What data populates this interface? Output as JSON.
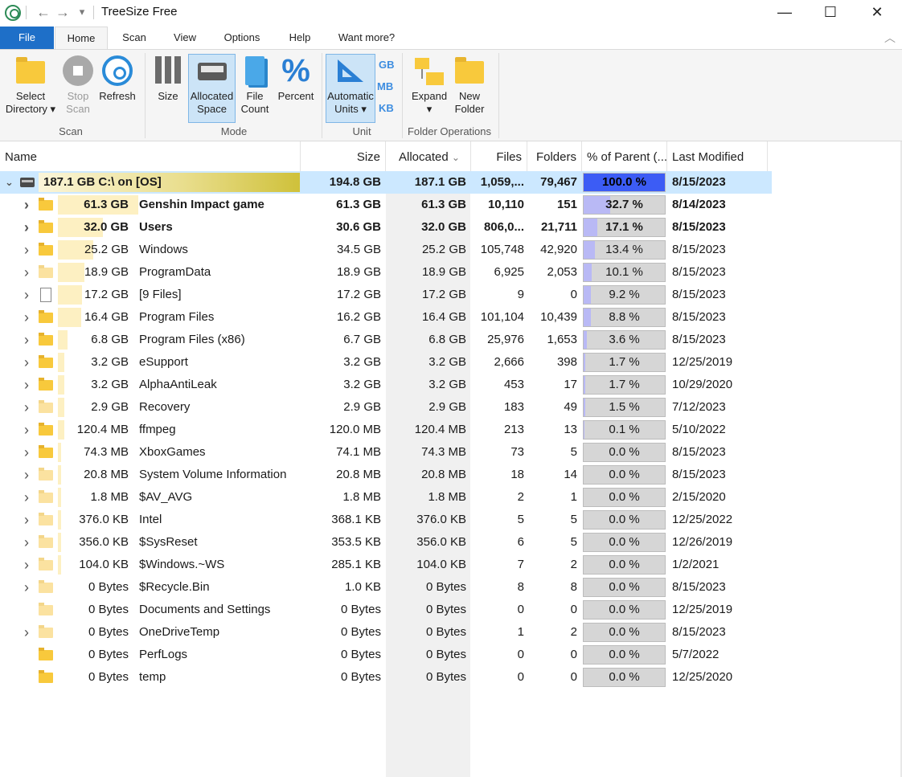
{
  "window": {
    "title": "TreeSize Free",
    "minimize_icon": "—",
    "maximize_icon": "☐",
    "close_icon": "✕",
    "back_icon": "←",
    "forward_icon": "→",
    "quickaccess_icon": "▾"
  },
  "ribbon_tabs": [
    "File",
    "Home",
    "Scan",
    "View",
    "Options",
    "Help",
    "Want more?"
  ],
  "collapse_icon": "︿",
  "ribbon": {
    "scan_group": {
      "label": "Scan",
      "select_directory": [
        "Select",
        "Directory ▾"
      ],
      "stop_scan": [
        "Stop",
        "Scan"
      ],
      "refresh": "Refresh"
    },
    "mode_group": {
      "label": "Mode",
      "size": "Size",
      "allocated_space": [
        "Allocated",
        "Space"
      ],
      "file_count": [
        "File",
        "Count"
      ],
      "percent": "Percent",
      "percent_glyph": "%"
    },
    "unit_group": {
      "label": "Unit",
      "automatic_units": [
        "Automatic",
        "Units ▾"
      ],
      "gb": "GB",
      "mb": "MB",
      "kb": "KB"
    },
    "folder_ops_group": {
      "label": "Folder Operations",
      "expand": [
        "Expand",
        "▾"
      ],
      "new_folder": [
        "New",
        "Folder"
      ]
    }
  },
  "columns": [
    "Name",
    "Size",
    "Allocated",
    "Files",
    "Folders",
    "% of Parent (...",
    "Last Modified"
  ],
  "sort_indicator": "⌄",
  "root": {
    "label": "187.1 GB   C:\\  on  [OS]",
    "size": "194.8 GB",
    "allocated": "187.1 GB",
    "files": "1,059,...",
    "folders": "79,467",
    "percent": "100.0 %",
    "percent_value": 100.0,
    "modified": "8/15/2023"
  },
  "rows": [
    {
      "alloc_label": "61.3 GB",
      "name": "Genshin Impact game",
      "size": "61.3 GB",
      "allocated": "61.3 GB",
      "files": "10,110",
      "folders": "151",
      "percent": "32.7 %",
      "percent_value": 32.7,
      "modified": "8/14/2023",
      "bold": true,
      "expandable": true,
      "icon": "folder"
    },
    {
      "alloc_label": "32.0 GB",
      "name": "Users",
      "size": "30.6 GB",
      "allocated": "32.0 GB",
      "files": "806,0...",
      "folders": "21,711",
      "percent": "17.1 %",
      "percent_value": 17.1,
      "modified": "8/15/2023",
      "bold": true,
      "expandable": true,
      "icon": "folder"
    },
    {
      "alloc_label": "25.2 GB",
      "name": "Windows",
      "size": "34.5 GB",
      "allocated": "25.2 GB",
      "files": "105,748",
      "folders": "42,920",
      "percent": "13.4 %",
      "percent_value": 13.4,
      "modified": "8/15/2023",
      "bold": false,
      "expandable": true,
      "icon": "folder"
    },
    {
      "alloc_label": "18.9 GB",
      "name": "ProgramData",
      "size": "18.9 GB",
      "allocated": "18.9 GB",
      "files": "6,925",
      "folders": "2,053",
      "percent": "10.1 %",
      "percent_value": 10.1,
      "modified": "8/15/2023",
      "bold": false,
      "expandable": true,
      "icon": "folder-light"
    },
    {
      "alloc_label": "17.2 GB",
      "name": "[9 Files]",
      "size": "17.2 GB",
      "allocated": "17.2 GB",
      "files": "9",
      "folders": "0",
      "percent": "9.2 %",
      "percent_value": 9.2,
      "modified": "8/15/2023",
      "bold": false,
      "expandable": true,
      "icon": "file"
    },
    {
      "alloc_label": "16.4 GB",
      "name": "Program Files",
      "size": "16.2 GB",
      "allocated": "16.4 GB",
      "files": "101,104",
      "folders": "10,439",
      "percent": "8.8 %",
      "percent_value": 8.8,
      "modified": "8/15/2023",
      "bold": false,
      "expandable": true,
      "icon": "folder"
    },
    {
      "alloc_label": "6.8 GB",
      "name": "Program Files (x86)",
      "size": "6.7 GB",
      "allocated": "6.8 GB",
      "files": "25,976",
      "folders": "1,653",
      "percent": "3.6 %",
      "percent_value": 3.6,
      "modified": "8/15/2023",
      "bold": false,
      "expandable": true,
      "icon": "folder"
    },
    {
      "alloc_label": "3.2 GB",
      "name": "eSupport",
      "size": "3.2 GB",
      "allocated": "3.2 GB",
      "files": "2,666",
      "folders": "398",
      "percent": "1.7 %",
      "percent_value": 1.7,
      "modified": "12/25/2019",
      "bold": false,
      "expandable": true,
      "icon": "folder"
    },
    {
      "alloc_label": "3.2 GB",
      "name": "AlphaAntiLeak",
      "size": "3.2 GB",
      "allocated": "3.2 GB",
      "files": "453",
      "folders": "17",
      "percent": "1.7 %",
      "percent_value": 1.7,
      "modified": "10/29/2020",
      "bold": false,
      "expandable": true,
      "icon": "folder"
    },
    {
      "alloc_label": "2.9 GB",
      "name": "Recovery",
      "size": "2.9 GB",
      "allocated": "2.9 GB",
      "files": "183",
      "folders": "49",
      "percent": "1.5 %",
      "percent_value": 1.5,
      "modified": "7/12/2023",
      "bold": false,
      "expandable": true,
      "icon": "folder-light"
    },
    {
      "alloc_label": "120.4 MB",
      "name": "ffmpeg",
      "size": "120.0 MB",
      "allocated": "120.4 MB",
      "files": "213",
      "folders": "13",
      "percent": "0.1 %",
      "percent_value": 0.1,
      "modified": "5/10/2022",
      "bold": false,
      "expandable": true,
      "icon": "folder"
    },
    {
      "alloc_label": "74.3 MB",
      "name": "XboxGames",
      "size": "74.1 MB",
      "allocated": "74.3 MB",
      "files": "73",
      "folders": "5",
      "percent": "0.0 %",
      "percent_value": 0.0,
      "modified": "8/15/2023",
      "bold": false,
      "expandable": true,
      "icon": "folder"
    },
    {
      "alloc_label": "20.8 MB",
      "name": "System Volume Information",
      "size": "20.8 MB",
      "allocated": "20.8 MB",
      "files": "18",
      "folders": "14",
      "percent": "0.0 %",
      "percent_value": 0.0,
      "modified": "8/15/2023",
      "bold": false,
      "expandable": true,
      "icon": "folder-light"
    },
    {
      "alloc_label": "1.8 MB",
      "name": "$AV_AVG",
      "size": "1.8 MB",
      "allocated": "1.8 MB",
      "files": "2",
      "folders": "1",
      "percent": "0.0 %",
      "percent_value": 0.0,
      "modified": "2/15/2020",
      "bold": false,
      "expandable": true,
      "icon": "folder-light"
    },
    {
      "alloc_label": "376.0 KB",
      "name": "Intel",
      "size": "368.1 KB",
      "allocated": "376.0 KB",
      "files": "5",
      "folders": "5",
      "percent": "0.0 %",
      "percent_value": 0.0,
      "modified": "12/25/2022",
      "bold": false,
      "expandable": true,
      "icon": "folder-light"
    },
    {
      "alloc_label": "356.0 KB",
      "name": "$SysReset",
      "size": "353.5 KB",
      "allocated": "356.0 KB",
      "files": "6",
      "folders": "5",
      "percent": "0.0 %",
      "percent_value": 0.0,
      "modified": "12/26/2019",
      "bold": false,
      "expandable": true,
      "icon": "folder-light"
    },
    {
      "alloc_label": "104.0 KB",
      "name": "$Windows.~WS",
      "size": "285.1 KB",
      "allocated": "104.0 KB",
      "files": "7",
      "folders": "2",
      "percent": "0.0 %",
      "percent_value": 0.0,
      "modified": "1/2/2021",
      "bold": false,
      "expandable": true,
      "icon": "folder-light"
    },
    {
      "alloc_label": "0 Bytes",
      "name": "$Recycle.Bin",
      "size": "1.0 KB",
      "allocated": "0 Bytes",
      "files": "8",
      "folders": "8",
      "percent": "0.0 %",
      "percent_value": 0.0,
      "modified": "8/15/2023",
      "bold": false,
      "expandable": true,
      "icon": "folder-light"
    },
    {
      "alloc_label": "0 Bytes",
      "name": "Documents and Settings",
      "size": "0 Bytes",
      "allocated": "0 Bytes",
      "files": "0",
      "folders": "0",
      "percent": "0.0 %",
      "percent_value": 0.0,
      "modified": "12/25/2019",
      "bold": false,
      "expandable": false,
      "icon": "folder-link"
    },
    {
      "alloc_label": "0 Bytes",
      "name": "OneDriveTemp",
      "size": "0 Bytes",
      "allocated": "0 Bytes",
      "files": "1",
      "folders": "2",
      "percent": "0.0 %",
      "percent_value": 0.0,
      "modified": "8/15/2023",
      "bold": false,
      "expandable": true,
      "icon": "folder-light"
    },
    {
      "alloc_label": "0 Bytes",
      "name": "PerfLogs",
      "size": "0 Bytes",
      "allocated": "0 Bytes",
      "files": "0",
      "folders": "0",
      "percent": "0.0 %",
      "percent_value": 0.0,
      "modified": "5/7/2022",
      "bold": false,
      "expandable": false,
      "icon": "folder"
    },
    {
      "alloc_label": "0 Bytes",
      "name": "temp",
      "size": "0 Bytes",
      "allocated": "0 Bytes",
      "files": "0",
      "folders": "0",
      "percent": "0.0 %",
      "percent_value": 0.0,
      "modified": "12/25/2020",
      "bold": false,
      "expandable": false,
      "icon": "folder"
    }
  ],
  "colors": {
    "accent": "#1e6fc8",
    "selection": "#cce8ff",
    "percent_bar": "#b9b9f5",
    "root_percent_bar": "#3c5cf5",
    "size_bar": "#fdf0c2"
  }
}
